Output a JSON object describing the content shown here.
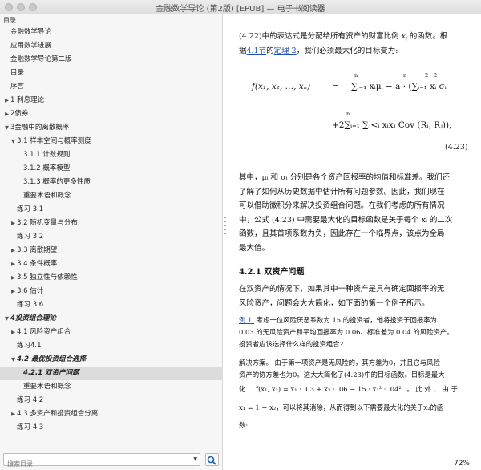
{
  "window": {
    "title": "金融数学导论 (第2版) [EPUB] — 电子书阅读器"
  },
  "sidebar": {
    "header": "目录",
    "toc": [
      {
        "label": "金融数学导论",
        "level": 0,
        "arrow": ""
      },
      {
        "label": "应用数学进展",
        "level": 0,
        "arrow": ""
      },
      {
        "label": "金融数学导论第二版",
        "level": 0,
        "arrow": ""
      },
      {
        "label": "目录",
        "level": 0,
        "arrow": ""
      },
      {
        "label": "序言",
        "level": 0,
        "arrow": ""
      },
      {
        "label": "1 利息理论",
        "level": 0,
        "arrow": "▶"
      },
      {
        "label": "2债券",
        "level": 0,
        "arrow": "▶"
      },
      {
        "label": "3金融中的离散概率",
        "level": 0,
        "arrow": "▼"
      },
      {
        "label": "3.1 样本空间与概率测度",
        "level": 1,
        "arrow": "▼"
      },
      {
        "label": "3.1.1 计数规则",
        "level": 2,
        "arrow": ""
      },
      {
        "label": "3.1.2 概率模型",
        "level": 2,
        "arrow": ""
      },
      {
        "label": "3.1.3 概率的更多性质",
        "level": 2,
        "arrow": ""
      },
      {
        "label": "重要术语和概念",
        "level": 2,
        "arrow": ""
      },
      {
        "label": "练习 3.1",
        "level": 1,
        "arrow": ""
      },
      {
        "label": "3.2 随机变量与分布",
        "level": 1,
        "arrow": "▶"
      },
      {
        "label": "练习 3.2",
        "level": 1,
        "arrow": ""
      },
      {
        "label": "3.3 离散期望",
        "level": 1,
        "arrow": "▶"
      },
      {
        "label": "3.4 条件概率",
        "level": 1,
        "arrow": "▶"
      },
      {
        "label": "3.5 独立性与依赖性",
        "level": 1,
        "arrow": "▶"
      },
      {
        "label": "3.6 估计",
        "level": 1,
        "arrow": "▶"
      },
      {
        "label": "练习 3.6",
        "level": 1,
        "arrow": ""
      },
      {
        "label": "4投资组合理论",
        "level": 0,
        "arrow": "▼",
        "style": "bold-italic"
      },
      {
        "label": "4.1 风险资产组合",
        "level": 1,
        "arrow": "▶"
      },
      {
        "label": "练习4.1",
        "level": 1,
        "arrow": ""
      },
      {
        "label": "4.2 最优投资组合选择",
        "level": 1,
        "arrow": "▼",
        "style": "bold-italic"
      },
      {
        "label": "4.2.1 双资产问题",
        "level": 2,
        "arrow": "",
        "style": "bold-italic"
      },
      {
        "label": "重要术语和概念",
        "level": 2,
        "arrow": ""
      },
      {
        "label": "练习 4.2",
        "level": 1,
        "arrow": ""
      },
      {
        "label": "4.3 多资产和投资组合分离",
        "level": 1,
        "arrow": "▶"
      },
      {
        "label": "练习 4.3",
        "level": 1,
        "arrow": ""
      }
    ],
    "search": {
      "placeholder": "搜索目录"
    }
  },
  "content": {
    "para1": {
      "l1_a": "(4.22)中的表达式是分配给所有资产的财富比例 ",
      "l1_var": "x",
      "l1_sub": "i",
      "l1_b": " 的函数。根",
      "l2_a": "据",
      "l2_link1": "4.1节",
      "l2_b": "的",
      "l2_link2": "定理 2",
      "l2_c": "，我们必须最大化的目标变为:"
    },
    "equation": {
      "lhs": "f(x₁, x₂, …, xₙ)",
      "eq": "=",
      "n_top_1": "n",
      "n_top_2": "n",
      "exp_2a": "2",
      "exp_2b": "2",
      "rhs1": "∑ᵢ₌₁ xᵢμᵢ − a · (∑ᵢ₌₁ xᵢ σᵢ",
      "n_top_3": "n",
      "rhs2": "+2∑ᵢ₌₁ ∑ⱼ<ᵢ xᵢxⱼ Cov (Rᵢ, Rⱼ)),",
      "number": "(4.23)"
    },
    "para2": [
      "其中，μᵢ 和 σᵢ 分别是各个资产回报率的均值和标准差。我们还",
      "了解了如何从历史数据中估计所有问题参数。因此，我们现在",
      "可以借助微积分来解决投资组合问题。在我们考虑的所有情况",
      "中，公式 (4.23) 中需要最大化的目标函数是关于每个 xᵢ 的二次",
      "函数，且其首项系数为负，因此存在一个临界点，该点为全局",
      "最大值。"
    ],
    "section_heading": "4.2.1 双资产问题",
    "para3": [
      "在双资产的情况下，如果其中一种资产是具有确定回报率的无",
      "风险资产，问题会大大简化，如下面的第一个例子所示。"
    ],
    "example": {
      "link": "例 1.",
      "l1": " 考虑一位风险厌恶系数为 15 的投资者，他将投资于回报率为",
      "l2": "0.03 的无风险资产和平均回报率为 0.06、标准差为 0.04 的风险资产。",
      "l3": "投资者应该选择什么样的投资组合?"
    },
    "solution": {
      "l1": "解决方案。 由于第一项资产是无风险的，其方差为0，并且它与风险",
      "l2": "资产的协方差也为0。这大大简化了(4.23)中的目标函数。目标是最大",
      "l3a": "化",
      "l3b": "f(x₁, x₂) = x₁ · .03 + x₂ · .06 − 15 · x₂² · .04²",
      "l3c": "。 此 外 ， 由 于",
      "l4a": "x₁ = 1 − x₂",
      "l4b": "，可以将其消除，从而得到以下需要最大化的关于x₂的函",
      "l5": "数:"
    },
    "zoom": "72%"
  }
}
